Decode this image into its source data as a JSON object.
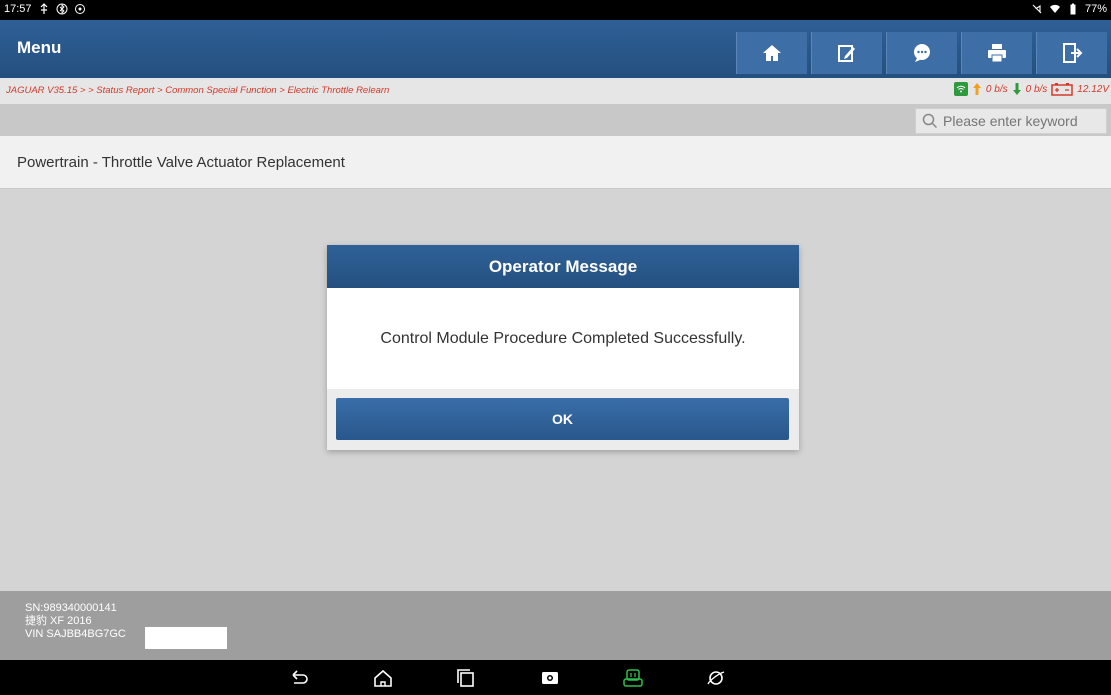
{
  "status_bar": {
    "time": "17:57",
    "battery": "77%"
  },
  "menu": {
    "title": "Menu",
    "buttons": [
      "home",
      "edit",
      "chat",
      "print",
      "exit"
    ]
  },
  "breadcrumb": {
    "text": "JAGUAR V35.15 >  > Status Report > Common Special Function > Electric Throttle Relearn",
    "upload": "0 b/s",
    "download": "0 b/s",
    "voltage": "12.12V"
  },
  "search": {
    "placeholder": "Please enter keyword"
  },
  "page": {
    "title": "Powertrain - Throttle Valve Actuator Replacement"
  },
  "dialog": {
    "title": "Operator Message",
    "message": "Control Module Procedure Completed Successfully.",
    "ok_label": "OK"
  },
  "footer": {
    "sn": "SN:989340000141",
    "model": "捷豹 XF 2016",
    "vin": "VIN SAJBB4BG7GC"
  },
  "nav": [
    "back-icon",
    "home-icon",
    "recents-icon",
    "screenshot-icon",
    "vci-icon",
    "browser-icon"
  ],
  "colors": {
    "accent": "#2f5f96",
    "breadcrumb_text": "#d23a2a",
    "status_green": "#2e9a3e"
  }
}
